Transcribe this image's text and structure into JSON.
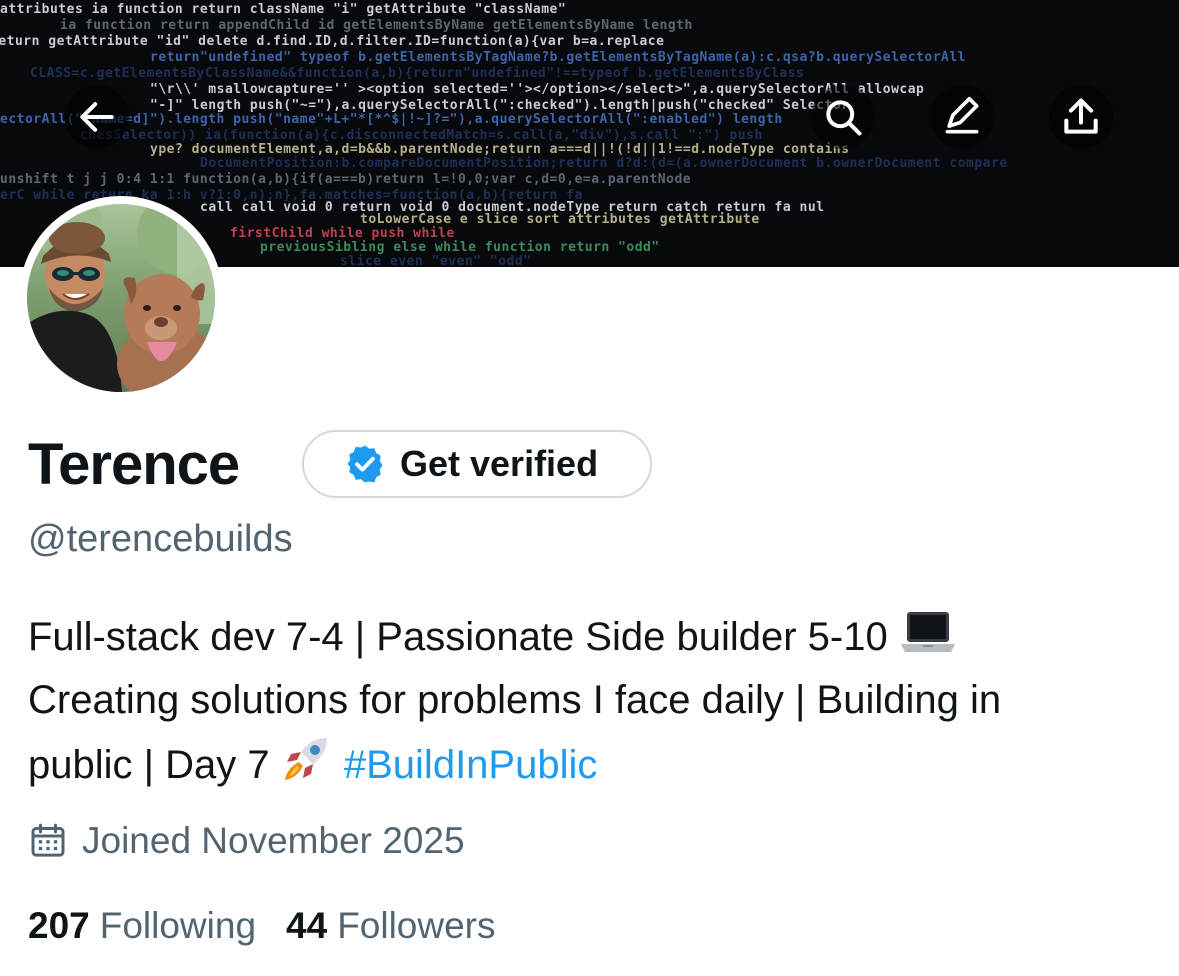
{
  "profile": {
    "display_name": "Terence",
    "handle": "@terencebuilds",
    "verify_label": "Get verified",
    "bio": {
      "line1": "Full-stack dev 7-4 | Passionate Side builder 5-10",
      "line1_emoji": "laptop-emoji",
      "line2": "Creating solutions for problems I face daily | Building in",
      "line3": "public | Day 7",
      "line3_emoji": "rocket-emoji",
      "hashtag": "#BuildInPublic"
    },
    "joined": "Joined November 2025",
    "following_count": "207",
    "following_label": "Following",
    "followers_count": "44",
    "followers_label": "Followers"
  },
  "banner": {
    "code_lines": [
      "attributes ia function  return  className \"i\"  getAttribute \"className\"",
      "ia function  return  appendChild  id   getElementsByName   getElementsByName  length",
      "return  getAttribute \"id\"   delete d.find.ID,d.filter.ID=function(a){var b=a.replace",
      "return\"undefined\"  typeof b.getElementsByTagName?b.getElementsByTagName(a):c.qsa?b.querySelectorAll",
      "CLASS=c.getElementsByClassName&&function(a,b){return\"undefined\"!==typeof b.getElementsByClass",
      "\"\\r\\\\' msallowcapture='' ><option selected=''></option></select>\",a.querySelectorAll  allowcap",
      "\"-]\"  length  push(\"~=\"),a.querySelectorAll(\":checked\").length|push(\"checked\"  Selector",
      "ectorAll(\"[name=d]\").length  push(\"name\"+L+\"*[*^$|!~]?=\"),a.querySelectorAll(\":enabled\") length",
      "chesSelector))  ia(function(a){c.disconnectedMatch=s.call(a,\"div\"),s.call  \":\")  push",
      "ype?  documentElement,a,d=b&&b.parentNode;return  a===d||!(!d||1!==d.nodeType  contains",
      "DocumentPosition:b.compareDocumentPosition;return  d?d:(d=(a.ownerDocument  b.ownerDocument  compare",
      "unshift  t  j  j  0:4  1:1  function(a,b){if(a===b)return l=!0,0;var c,d=0,e=a.parentNode",
      "erC  while  return  ka  1:h  v?1:0,n);n},fa.matches=function(a,b){return fa",
      "call  call  void 0  return void 0  document.nodeType  return  catch  return fa  nul",
      "toLowerCase  e  slice  sort  attributes  getAttribute",
      "firstChild  while  push  while",
      "previousSibling  else while  function  return  \"odd\"",
      "slice  even  \"even\"  \"odd\""
    ]
  },
  "nav": {
    "back_icon": "arrow-left-icon",
    "search_icon": "search-icon",
    "edit_icon": "pencil-icon",
    "share_icon": "share-upload-icon"
  },
  "colors": {
    "accent": "#1d9bf0",
    "secondary_text": "#536471",
    "primary_text": "#0f1419",
    "border": "#cfd9de",
    "banner_bg": "#07090d"
  }
}
